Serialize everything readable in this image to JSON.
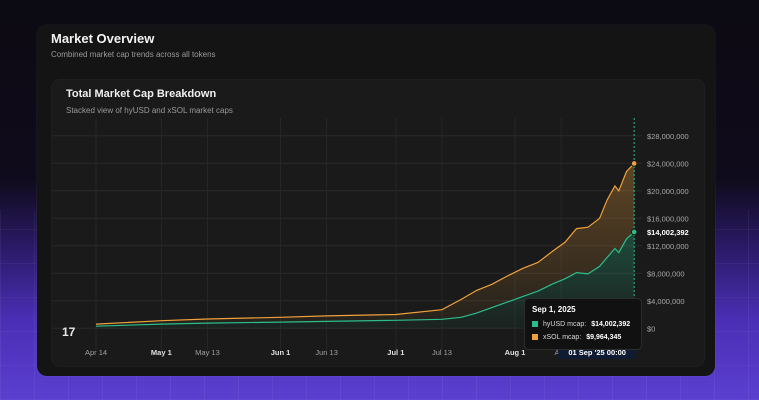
{
  "card": {
    "title": "Market Overview",
    "subtitle": "Combined market cap trends across all tokens"
  },
  "chart_data": {
    "type": "area",
    "stacked": true,
    "title": "Total Market Cap Breakdown",
    "subtitle": "Stacked view of hyUSD and xSOL market caps",
    "x_tick_labels": [
      {
        "label": "Apr 14",
        "date": "2025-04-14",
        "bold": false
      },
      {
        "label": "May 1",
        "date": "2025-05-01",
        "bold": true
      },
      {
        "label": "May 13",
        "date": "2025-05-13",
        "bold": false
      },
      {
        "label": "Jun 1",
        "date": "2025-06-01",
        "bold": true
      },
      {
        "label": "Jun 13",
        "date": "2025-06-13",
        "bold": false
      },
      {
        "label": "Jul 1",
        "date": "2025-07-01",
        "bold": true
      },
      {
        "label": "Jul 13",
        "date": "2025-07-13",
        "bold": false
      },
      {
        "label": "Aug 1",
        "date": "2025-08-01",
        "bold": true
      },
      {
        "label": "Aug",
        "date": "2025-08-13",
        "bold": false
      }
    ],
    "y_ticks": [
      {
        "value": 0,
        "label": "$0"
      },
      {
        "value": 4000000,
        "label": "$4,000,000"
      },
      {
        "value": 8000000,
        "label": "$8,000,000"
      },
      {
        "value": 12000000,
        "label": "$12,000,000"
      },
      {
        "value": 16000000,
        "label": "$16,000,000"
      },
      {
        "value": 20000000,
        "label": "$20,000,000"
      },
      {
        "value": 24000000,
        "label": "$24,000,000"
      },
      {
        "value": 28000000,
        "label": "$28,000,000"
      }
    ],
    "ylim": [
      -2000000,
      30000000
    ],
    "xlim": [
      "2025-04-14",
      "2025-09-02"
    ],
    "grid": true,
    "crosshair": {
      "date": "2025-09-01",
      "x_label": "01 Sep '25   00:00",
      "y_label": "$14,002,392",
      "y_value": 14002392
    },
    "series": [
      {
        "name": "hyUSD mcap",
        "color": "#2bbd8a",
        "points": [
          [
            "2025-04-14",
            300000
          ],
          [
            "2025-05-01",
            600000
          ],
          [
            "2025-05-13",
            750000
          ],
          [
            "2025-06-01",
            900000
          ],
          [
            "2025-06-13",
            1000000
          ],
          [
            "2025-07-01",
            1150000
          ],
          [
            "2025-07-13",
            1300000
          ],
          [
            "2025-07-18",
            1600000
          ],
          [
            "2025-07-22",
            2200000
          ],
          [
            "2025-07-26",
            3000000
          ],
          [
            "2025-07-30",
            3800000
          ],
          [
            "2025-08-03",
            4600000
          ],
          [
            "2025-08-07",
            5400000
          ],
          [
            "2025-08-11",
            6500000
          ],
          [
            "2025-08-14",
            7200000
          ],
          [
            "2025-08-17",
            8100000
          ],
          [
            "2025-08-20",
            7900000
          ],
          [
            "2025-08-23",
            9000000
          ],
          [
            "2025-08-25",
            10300000
          ],
          [
            "2025-08-27",
            11600000
          ],
          [
            "2025-08-28",
            11000000
          ],
          [
            "2025-08-30",
            13000000
          ],
          [
            "2025-09-01",
            14002392
          ]
        ]
      },
      {
        "name": "xSOL mcap",
        "color": "#f0a13c",
        "points": [
          [
            "2025-04-14",
            300000
          ],
          [
            "2025-05-01",
            500000
          ],
          [
            "2025-05-13",
            600000
          ],
          [
            "2025-06-01",
            700000
          ],
          [
            "2025-06-13",
            800000
          ],
          [
            "2025-07-01",
            850000
          ],
          [
            "2025-07-13",
            1400000
          ],
          [
            "2025-07-18",
            2600000
          ],
          [
            "2025-07-22",
            3300000
          ],
          [
            "2025-07-26",
            3400000
          ],
          [
            "2025-07-30",
            3800000
          ],
          [
            "2025-08-03",
            4100000
          ],
          [
            "2025-08-07",
            4200000
          ],
          [
            "2025-08-11",
            4800000
          ],
          [
            "2025-08-14",
            5300000
          ],
          [
            "2025-08-17",
            6400000
          ],
          [
            "2025-08-20",
            6800000
          ],
          [
            "2025-08-23",
            7000000
          ],
          [
            "2025-08-25",
            8400000
          ],
          [
            "2025-08-27",
            9100000
          ],
          [
            "2025-08-28",
            9000000
          ],
          [
            "2025-08-30",
            9800000
          ],
          [
            "2025-09-01",
            9964345
          ]
        ]
      }
    ]
  },
  "tooltip": {
    "date": "Sep 1, 2025",
    "rows": [
      {
        "label": "hyUSD mcap:",
        "value": "$14,002,392",
        "color": "#2bbd8a"
      },
      {
        "label": "xSOL mcap:",
        "value": "$9,964,345",
        "color": "#f0a13c"
      }
    ]
  },
  "logo_icon": "tradingview-logo-icon",
  "logo_text": "17"
}
